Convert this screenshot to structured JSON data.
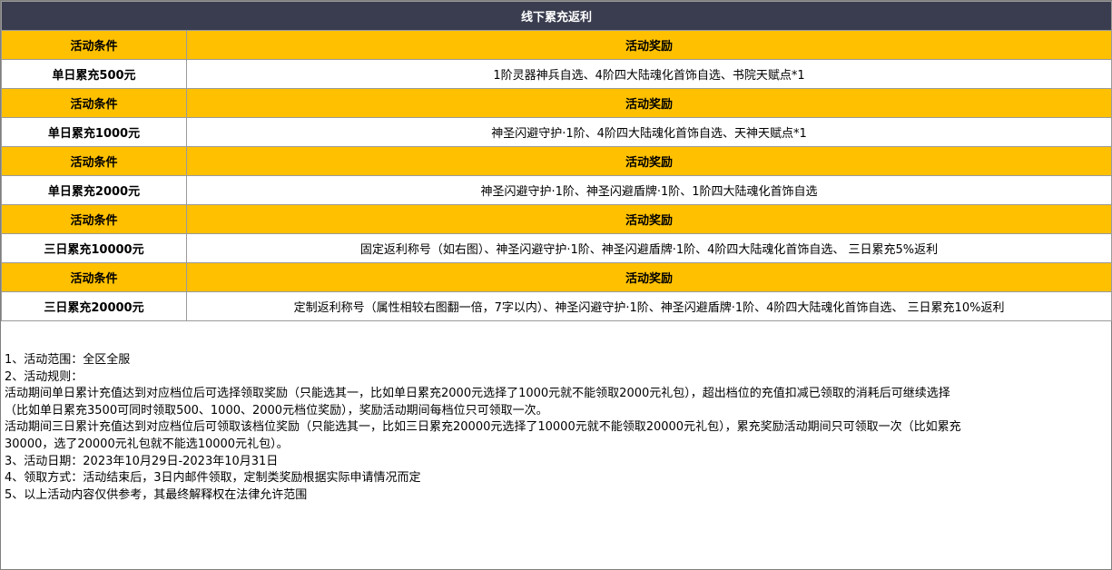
{
  "table": {
    "title": "线下累充返利",
    "header_condition": "活动条件",
    "header_reward": "活动奖励",
    "rows": [
      {
        "condition": "单日累充500元",
        "reward": "1阶灵器神兵自选、4阶四大陆魂化首饰自选、书院天赋点*1"
      },
      {
        "condition": "单日累充1000元",
        "reward": "神圣闪避守护·1阶、4阶四大陆魂化首饰自选、天神天赋点*1"
      },
      {
        "condition": "单日累充2000元",
        "reward": "神圣闪避守护·1阶、神圣闪避盾牌·1阶、1阶四大陆魂化首饰自选"
      },
      {
        "condition": "三日累充10000元",
        "reward": "固定返利称号（如右图）、神圣闪避守护·1阶、神圣闪避盾牌·1阶、4阶四大陆魂化首饰自选、 三日累充5%返利"
      },
      {
        "condition": "三日累充20000元",
        "reward": "定制返利称号（属性相较右图翻一倍，7字以内）、神圣闪避守护·1阶、神圣闪避盾牌·1阶、4阶四大陆魂化首饰自选、 三日累充10%返利"
      }
    ]
  },
  "notes": {
    "lines": [
      "1、活动范围：全区全服",
      "2、活动规则：",
      "活动期间单日累计充值达到对应档位后可选择领取奖励（只能选其一，比如单日累充2000元选择了1000元就不能领取2000元礼包），超出档位的充值扣减已领取的消耗后可继续选择",
      "（比如单日累充3500可同时领取500、1000、2000元档位奖励），奖励活动期间每档位只可领取一次。",
      "活动期间三日累计充值达到对应档位后可领取该档位奖励（只能选其一，比如三日累充20000元选择了10000元就不能领取20000元礼包），累充奖励活动期间只可领取一次（比如累充",
      "30000，选了20000元礼包就不能选10000元礼包）。",
      "3、活动日期：2023年10月29日-2023年10月31日",
      "4、领取方式：活动结束后，3日内邮件领取，定制类奖励根据实际申请情况而定",
      "5、以上活动内容仅供参考，其最终解释权在法律允许范围"
    ]
  },
  "colors": {
    "title_bg": "#3a3d4f",
    "header_bg": "#ffc000",
    "border": "#9a9a9a"
  }
}
